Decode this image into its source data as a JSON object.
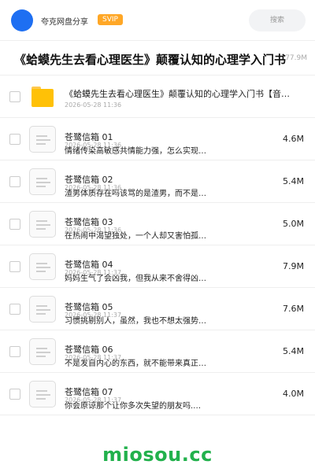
{
  "header": {
    "brand": "夸克网盘分享",
    "badge": "SVIP",
    "search_label": "搜索"
  },
  "share": {
    "title": "《蛤蟆先生去看心理医生》颠覆认知的心理学入门书",
    "total_size": "77.9M"
  },
  "folder": {
    "name": "《蛤蟆先生去看心理医生》颠覆认知的心理学入门书【音…",
    "date": "2026-05-28 11:36"
  },
  "files": [
    {
      "name": "苍鹭信箱 01",
      "date": "2026-05-28 11:36",
      "desc": "情绪传染高敏感共情能力强，怎么实现…",
      "size": "4.6M"
    },
    {
      "name": "苍鹭信箱 02",
      "date": "2026-05-28 11:36",
      "desc": "渣男体质存在吗该骂的是渣男，而不是…",
      "size": "5.4M"
    },
    {
      "name": "苍鹭信箱 03",
      "date": "2026-05-28 11:36",
      "desc": "在热闹中渴望独处，一个人却又害怕孤…",
      "size": "5.0M"
    },
    {
      "name": "苍鹭信箱 04",
      "date": "2026-05-28 11:37",
      "desc": "妈妈生气了会凶我，但我从来不舍得凶…",
      "size": "7.9M"
    },
    {
      "name": "苍鹭信箱 05",
      "date": "2026-05-28 11:37",
      "desc": "习惯挑剔别人，虽然，我也不想太强势…",
      "size": "7.6M"
    },
    {
      "name": "苍鹭信箱 06",
      "date": "2026-05-28 11:37",
      "desc": "不是发自内心的东西，就不能带来真正…",
      "size": "5.4M"
    },
    {
      "name": "苍鹭信箱 07",
      "date": "2026-05-28 11:37",
      "desc": "你会原谅那个让你多次失望的朋友吗.…",
      "size": "4.0M"
    }
  ],
  "watermark": "miosou.cc",
  "colors": {
    "accent": "#1e6ff2",
    "svip": "#ffa726",
    "folder": "#ffc107",
    "watermark": "#22b14c"
  }
}
